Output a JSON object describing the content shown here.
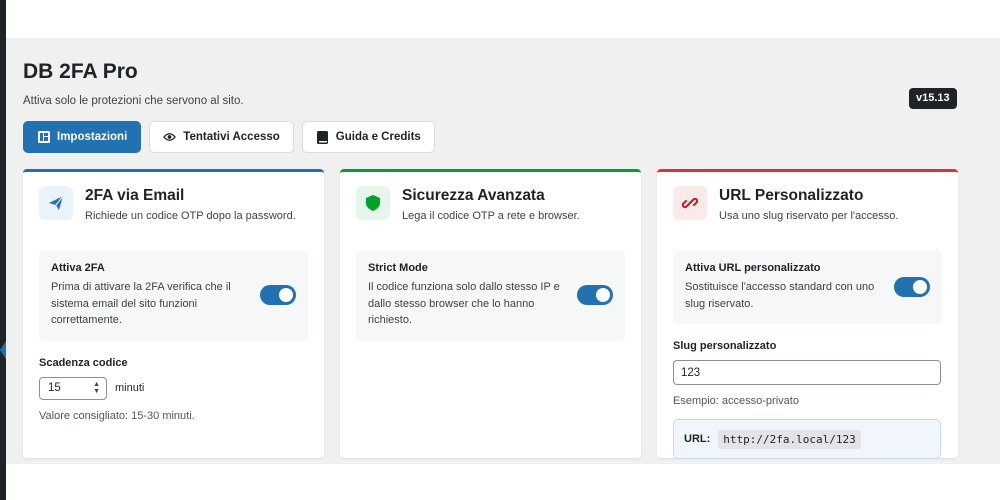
{
  "header": {
    "title": "DB 2FA Pro",
    "subtitle": "Attiva solo le protezioni che servono al sito.",
    "version": "v15.13"
  },
  "tabs": [
    {
      "label": "Impostazioni",
      "icon": "dashboard-icon",
      "active": true
    },
    {
      "label": "Tentativi Accesso",
      "icon": "eye-icon",
      "active": false
    },
    {
      "label": "Guida e Credits",
      "icon": "book-icon",
      "active": false
    }
  ],
  "cards": {
    "email": {
      "title": "2FA via Email",
      "description": "Richiede un codice OTP dopo la password.",
      "icon": "paper-plane-icon",
      "accent": "#2271b1",
      "option": {
        "title": "Attiva 2FA",
        "description": "Prima di attivare la 2FA verifica che il sistema email del sito funzioni correttamente.",
        "enabled": true
      },
      "expiry_label": "Scadenza codice",
      "expiry_value": "15",
      "expiry_unit": "minuti",
      "expiry_hint": "Valore consigliato: 15-30 minuti."
    },
    "security": {
      "title": "Sicurezza Avanzata",
      "description": "Lega il codice OTP a rete e browser.",
      "icon": "shield-icon",
      "accent": "#00a32a",
      "option": {
        "title": "Strict Mode",
        "description": "Il codice funziona solo dallo stesso IP e dallo stesso browser che lo hanno richiesto.",
        "enabled": true
      }
    },
    "url": {
      "title": "URL Personalizzato",
      "description": "Usa uno slug riservato per l'accesso.",
      "icon": "link-icon",
      "accent": "#d63638",
      "option": {
        "title": "Attiva URL personalizzato",
        "description": "Sostituisce l'accesso standard con uno slug riservato.",
        "enabled": true
      },
      "slug_label": "Slug personalizzato",
      "slug_value": "123",
      "slug_example": "Esempio: accesso-privato",
      "url_label": "URL:",
      "url_value": "http://2fa.local/123"
    }
  },
  "colors": {
    "primary": "#2271b1",
    "background": "#f0f0f1",
    "dark": "#1d2327"
  }
}
